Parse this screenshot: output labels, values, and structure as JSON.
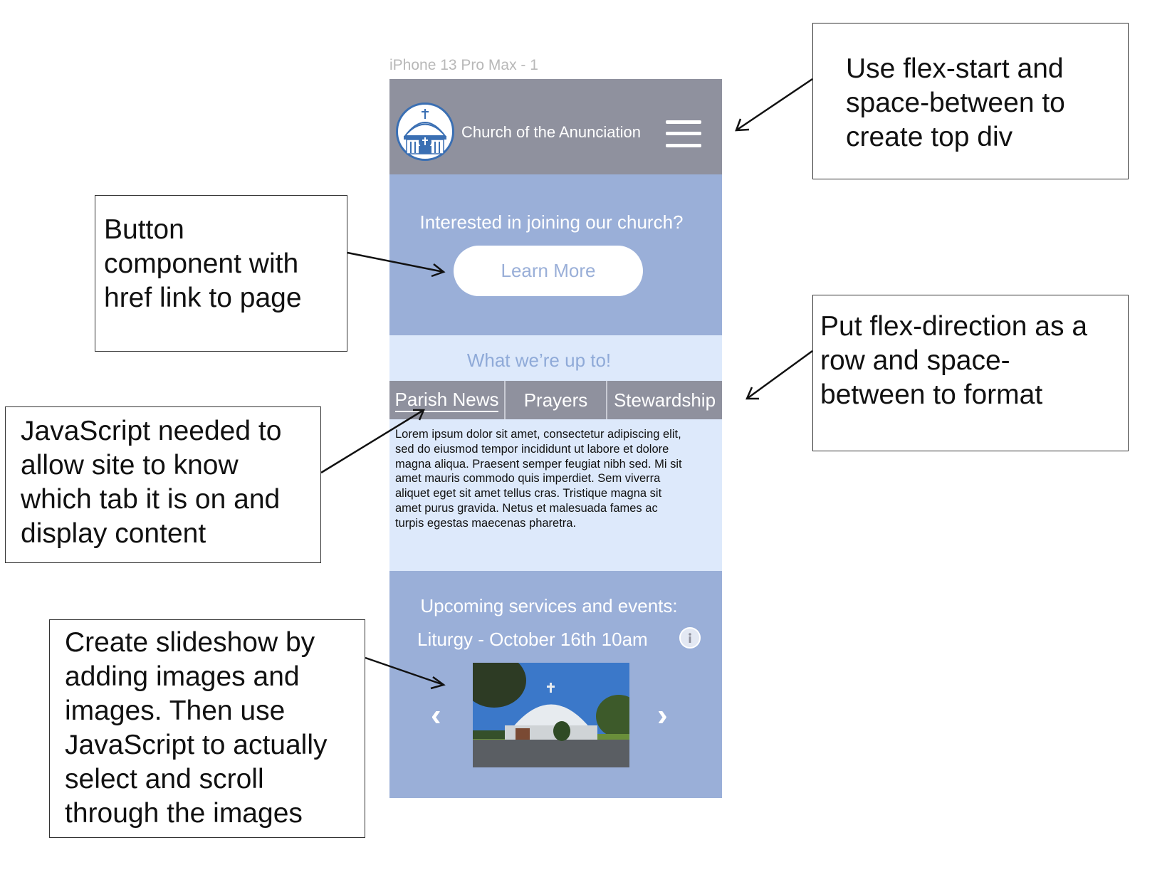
{
  "frame_label": "iPhone 13 Pro Max - 1",
  "header": {
    "title": "Church of the Anunciation",
    "logo_icon": "church-logo-icon",
    "menu_icon": "hamburger-menu-icon"
  },
  "join": {
    "question": "Interested in joining our church?",
    "button_label": "Learn More"
  },
  "news": {
    "title": "What we’re up to!",
    "tabs": [
      {
        "label": "Parish News",
        "active": true
      },
      {
        "label": "Prayers",
        "active": false
      },
      {
        "label": "Stewardship",
        "active": false
      }
    ],
    "lines": [
      "Lorem ipsum dolor sit amet, consectetur adipiscing elit,",
      "sed do eiusmod tempor incididunt ut labore et dolore",
      "magna aliqua. Praesent semper feugiat nibh sed. Mi sit",
      "amet mauris commodo quis imperdiet. Sem viverra",
      "aliquet eget sit amet tellus cras. Tristique magna sit",
      "amet purus gravida. Netus et malesuada fames ac",
      "turpis egestas maecenas pharetra."
    ]
  },
  "events": {
    "title": "Upcoming services and events:",
    "event": "Liturgy - October 16th 10am",
    "info_icon": "info-icon",
    "prev_glyph": "‹",
    "next_glyph": "›"
  },
  "notes": {
    "top_div": [
      "Use flex-start and",
      "space-between to",
      "create top div"
    ],
    "button": [
      "Button",
      "component with",
      "href link to page"
    ],
    "tabs_format": [
      "Put flex-direction as a",
      "row and space-",
      "between to format"
    ],
    "javascript": [
      "JavaScript needed to",
      "allow site to know",
      "which tab it is on and",
      "display content"
    ],
    "slideshow": [
      "Create slideshow by",
      "adding images and",
      "images. Then use",
      "JavaScript to actually",
      "select and scroll",
      "through the images"
    ]
  },
  "colors": {
    "header_bg": "#8f919e",
    "section_blue": "#9aafd8",
    "section_light": "#dde9fb",
    "accent_text": "#8faad8"
  }
}
